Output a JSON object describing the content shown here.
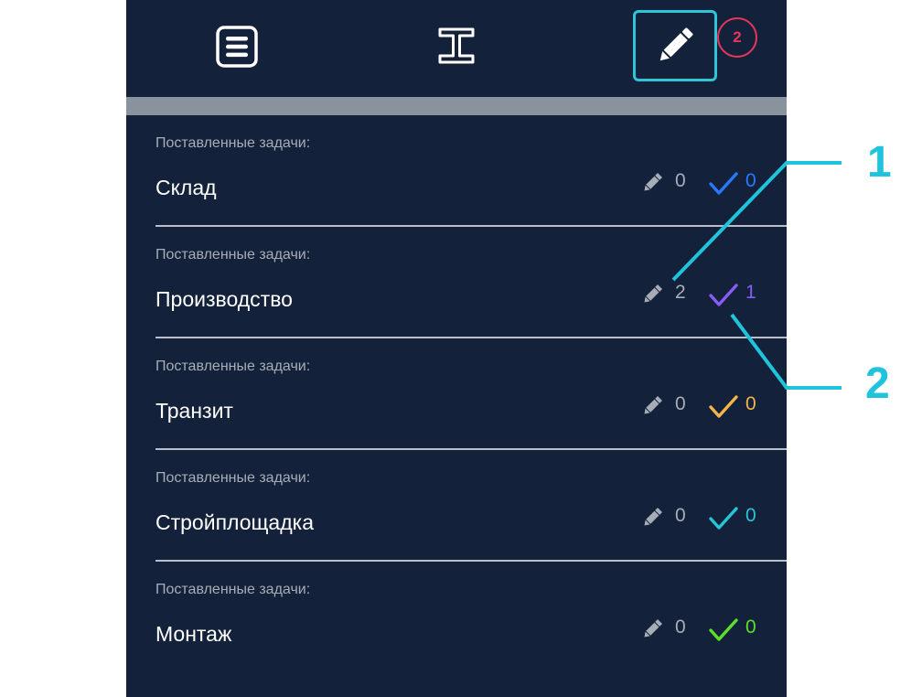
{
  "toolbar": {
    "list_icon": "list-icon",
    "beam_icon": "i-beam-icon",
    "edit_icon": "pencil-icon",
    "badge_count": "2",
    "accent": "#2fc4d6",
    "badge_color": "#e8355a"
  },
  "rows": [
    {
      "caption": "Поставленные задачи:",
      "title": "Склад",
      "edit_count": "0",
      "done_count": "0",
      "check_color": "#2a78ff"
    },
    {
      "caption": "Поставленные задачи:",
      "title": "Производство",
      "edit_count": "2",
      "done_count": "1",
      "check_color": "#8a5cf6"
    },
    {
      "caption": "Поставленные задачи:",
      "title": "Транзит",
      "edit_count": "0",
      "done_count": "0",
      "check_color": "#f5b54a"
    },
    {
      "caption": "Поставленные задачи:",
      "title": "Стройплощадка",
      "edit_count": "0",
      "done_count": "0",
      "check_color": "#27c6d6"
    },
    {
      "caption": "Поставленные задачи:",
      "title": "Монтаж",
      "edit_count": "0",
      "done_count": "0",
      "check_color": "#5be02a"
    }
  ],
  "callouts": [
    {
      "label": "1"
    },
    {
      "label": "2"
    }
  ],
  "colors": {
    "panel_bg": "#13213a",
    "callout": "#1fc3dc"
  }
}
